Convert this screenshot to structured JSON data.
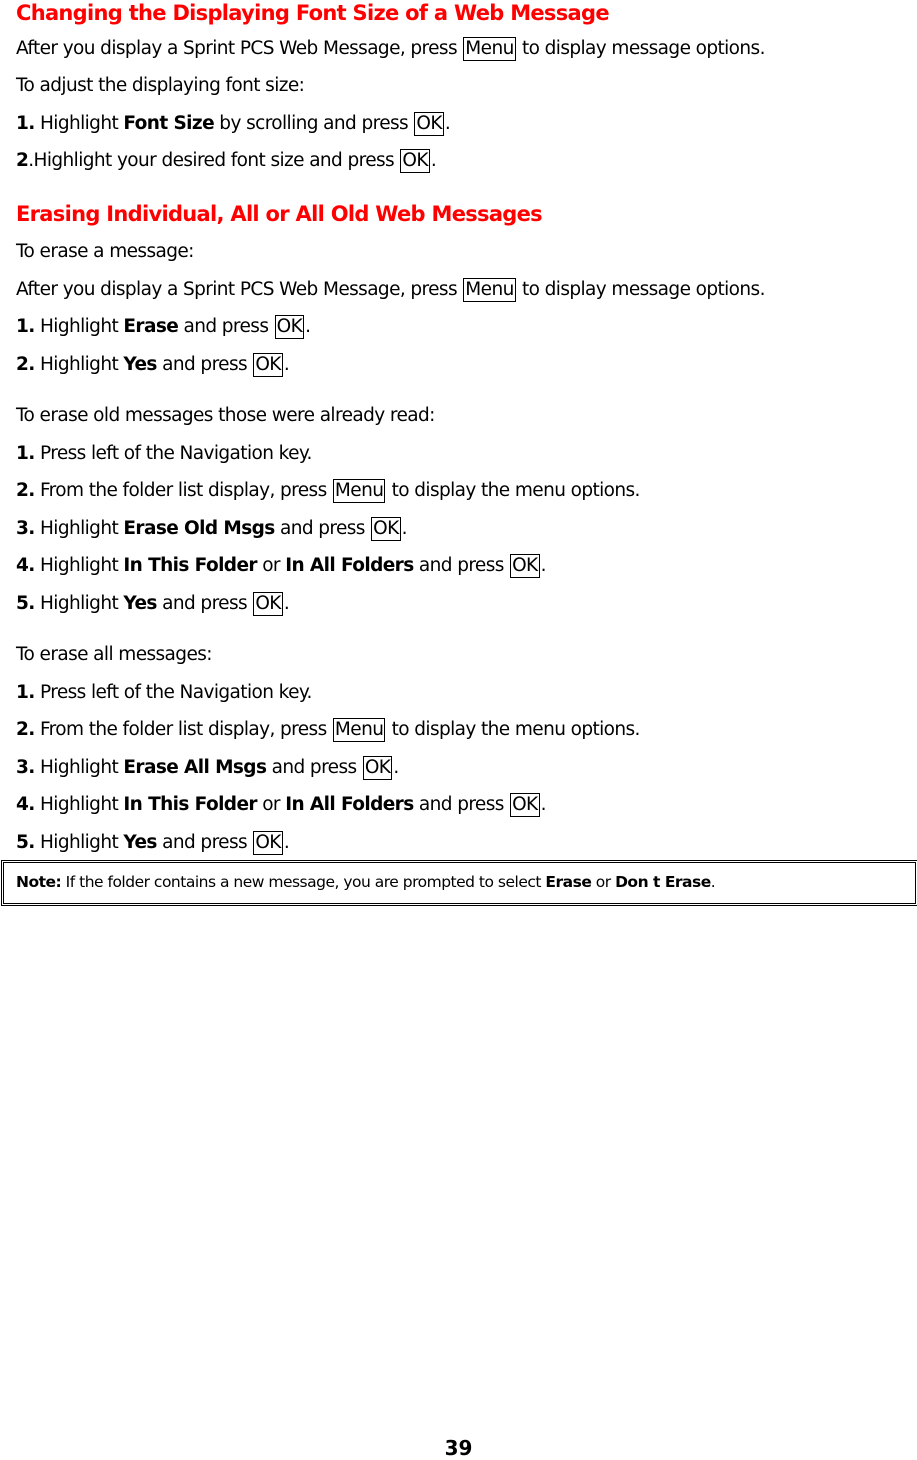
{
  "section1": {
    "heading": "Changing the Displaying Font Size of a Web Message",
    "intro_pre": "After you display a Sprint PCS Web Message, press ",
    "intro_key": "Menu",
    "intro_post": " to display message options.",
    "sub": "To adjust the displaying font size:",
    "steps": [
      {
        "num": "1.",
        "pre": " Highlight ",
        "bold": "Font Size",
        "mid": " by scrolling and press ",
        "key": "OK",
        "post": "."
      },
      {
        "num": "2",
        "pre": ".Highlight your desired font size and press ",
        "key": "OK",
        "post": "."
      }
    ]
  },
  "section2": {
    "heading": "Erasing Individual, All or All Old Web Messages",
    "sub_erase_one": "To erase a message:",
    "intro_pre": "After you display a Sprint PCS Web Message, press ",
    "intro_key": "Menu",
    "intro_post": " to display message options.",
    "erase_one_steps": [
      {
        "num": "1.",
        "pre": " Highlight ",
        "bold": "Erase",
        "mid": " and press ",
        "key": "OK",
        "post": "."
      },
      {
        "num": "2.",
        "pre": " Highlight ",
        "bold": "Yes",
        "mid": " and press ",
        "key": "OK",
        "post": "."
      }
    ],
    "sub_erase_old": "To erase old messages those were already read:",
    "erase_old_steps": [
      {
        "num": "1.",
        "text": " Press left of the Navigation key."
      },
      {
        "num": "2.",
        "pre": " From the folder list display, press ",
        "key": "Menu",
        "post": " to display the menu options."
      },
      {
        "num": "3.",
        "pre": " Highlight ",
        "bold": "Erase Old Msgs",
        "mid": " and press ",
        "key": "OK",
        "post": "."
      },
      {
        "num": "4.",
        "pre": " Highlight ",
        "bold": "In This Folder",
        "or": " or ",
        "bold2": "In All Folders",
        "mid": " and press ",
        "key": "OK",
        "post": "."
      },
      {
        "num": "5.",
        "pre": " Highlight ",
        "bold": "Yes",
        "mid": " and press ",
        "key": "OK",
        "post": "."
      }
    ],
    "sub_erase_all": "To erase all messages:",
    "erase_all_steps": [
      {
        "num": "1.",
        "text": " Press left of the Navigation key."
      },
      {
        "num": "2.",
        "pre": " From the folder list display, press ",
        "key": "Menu",
        "post": " to display the menu options."
      },
      {
        "num": "3.",
        "pre": " Highlight ",
        "bold": "Erase All Msgs",
        "mid": " and press ",
        "key": "OK",
        "post": "."
      },
      {
        "num": "4.",
        "pre": " Highlight ",
        "bold": "In This Folder",
        "or": " or ",
        "bold2": "In All Folders",
        "mid": " and press ",
        "key": "OK",
        "post": "."
      },
      {
        "num": "5.",
        "pre": " Highlight ",
        "bold": "Yes",
        "mid": " and press ",
        "key": "OK",
        "post": "."
      }
    ]
  },
  "note": {
    "label": "Note:",
    "text": " If the folder contains a new message, you are prompted to select ",
    "option1": "Erase",
    "or": " or ",
    "option2": "Don t Erase",
    "end": "."
  },
  "page_number": "39"
}
